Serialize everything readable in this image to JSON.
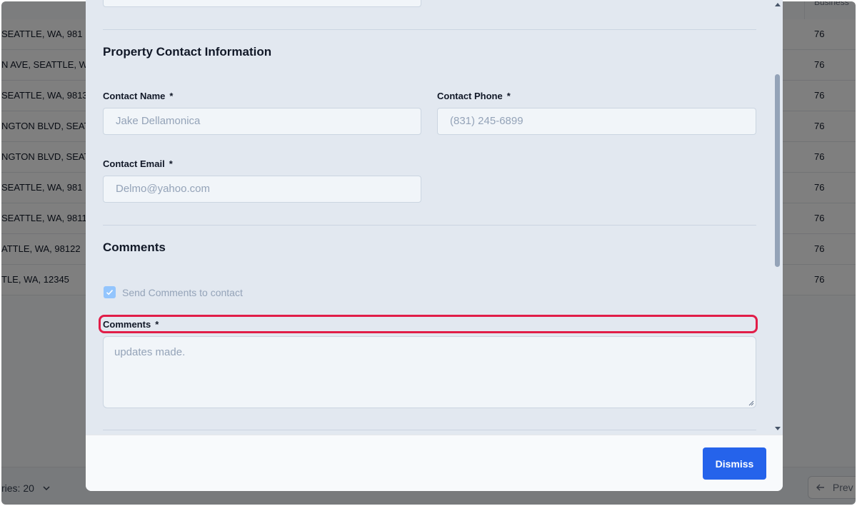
{
  "background": {
    "column_header": "Business",
    "rows": [
      {
        "address": "SEATTLE, WA, 981",
        "num": "76"
      },
      {
        "address": "N AVE, SEATTLE, W",
        "num": "76"
      },
      {
        "address": "SEATTLE, WA, 9813",
        "num": "76"
      },
      {
        "address": "NGTON BLVD, SEAT",
        "num": "76"
      },
      {
        "address": "NGTON BLVD, SEAT",
        "num": "76"
      },
      {
        "address": " SEATTLE, WA, 981",
        "num": "76"
      },
      {
        "address": "SEATTLE, WA, 9811",
        "num": "76"
      },
      {
        "address": "ATTLE, WA, 98122",
        "num": "76"
      },
      {
        "address": "TLE, WA, 12345",
        "num": "76"
      }
    ],
    "entries_label": "ries: 20",
    "prev_label": "Prev"
  },
  "contact_section": {
    "title": "Property Contact Information",
    "name_label": "Contact Name",
    "name_value": "Jake Dellamonica",
    "phone_label": "Contact Phone",
    "phone_value": "(831) 245-6899",
    "email_label": "Contact Email",
    "email_value": "Delmo@yahoo.com",
    "required_mark": "*"
  },
  "comments_section": {
    "title": "Comments",
    "checkbox_label": "Send Comments to contact",
    "checkbox_checked": true,
    "comments_label": "Comments",
    "comments_value": "updates made."
  },
  "footer": {
    "dismiss_label": "Dismiss"
  },
  "colors": {
    "accent": "#2563eb",
    "highlight": "#e11d48"
  }
}
